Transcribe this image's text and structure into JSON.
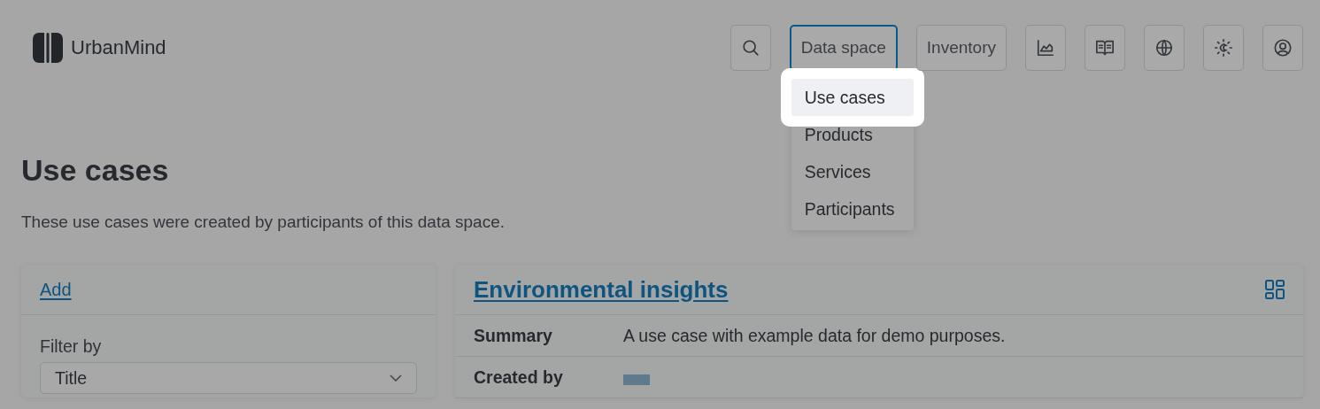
{
  "header": {
    "logo": "UrbanMind",
    "nav": [
      {
        "kind": "icon"
      },
      {
        "kind": "menu",
        "label": "Data space",
        "expanded": true,
        "menu": [
          {
            "label": "Use cases",
            "selected": true
          },
          {
            "label": "Products",
            "selected": false
          },
          {
            "label": "Services",
            "selected": false
          },
          {
            "label": "Participants",
            "selected": false
          }
        ]
      },
      {
        "kind": "menu",
        "label": "Inventory",
        "expanded": false
      },
      {
        "kind": "icon"
      },
      {
        "kind": "icon"
      },
      {
        "kind": "icon"
      },
      {
        "kind": "icon"
      },
      {
        "kind": "icon"
      }
    ]
  },
  "page": {
    "title": "Use cases",
    "intro": "These use cases were created by participants of this data space."
  },
  "sidebar": {
    "add_link": "Add",
    "filter_label": "Filter by",
    "filter_value": "Title"
  },
  "card": {
    "title": "Environmental insights",
    "fields": [
      {
        "kind": "text",
        "label": "Summary",
        "value": "A use case with example data for demo purposes."
      },
      {
        "kind": "avatar",
        "label": "Created by"
      }
    ]
  }
}
